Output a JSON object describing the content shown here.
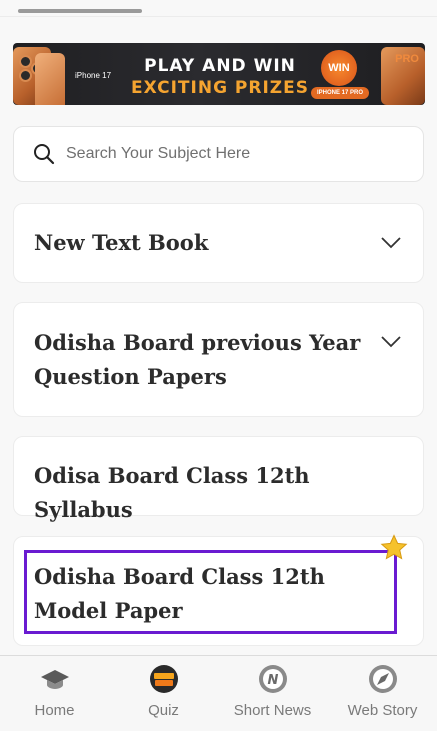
{
  "banner": {
    "brand": "iPhone 17",
    "line1": "PLAY AND WIN",
    "line2": "EXCITING PRIZES",
    "badge": "WIN",
    "badge_caption": "IPHONE 17 PRO",
    "pro_tag": "PRO"
  },
  "search": {
    "placeholder": "Search Your Subject Here",
    "value": "",
    "icon": "search-icon"
  },
  "cards": [
    {
      "title": "New Text Book",
      "expandable": true
    },
    {
      "title": "Odisha Board previous Year Question Papers",
      "expandable": true
    },
    {
      "title": "Odisa Board Class 12th Syllabus",
      "expandable": false
    },
    {
      "title": "Odisha Board Class 12th Model Paper",
      "expandable": false,
      "highlighted": true,
      "badge_icon": "star-icon"
    }
  ],
  "nav": {
    "items": [
      {
        "label": "Home",
        "icon": "graduation-cap-icon"
      },
      {
        "label": "Quiz",
        "icon": "quiz-time-icon"
      },
      {
        "label": "Short News",
        "icon": "news-n-icon"
      },
      {
        "label": "Web Story",
        "icon": "compass-icon"
      }
    ]
  },
  "colors": {
    "highlight": "#6a1bd1",
    "accent_orange": "#f5a430",
    "star": "#f6c22b"
  }
}
